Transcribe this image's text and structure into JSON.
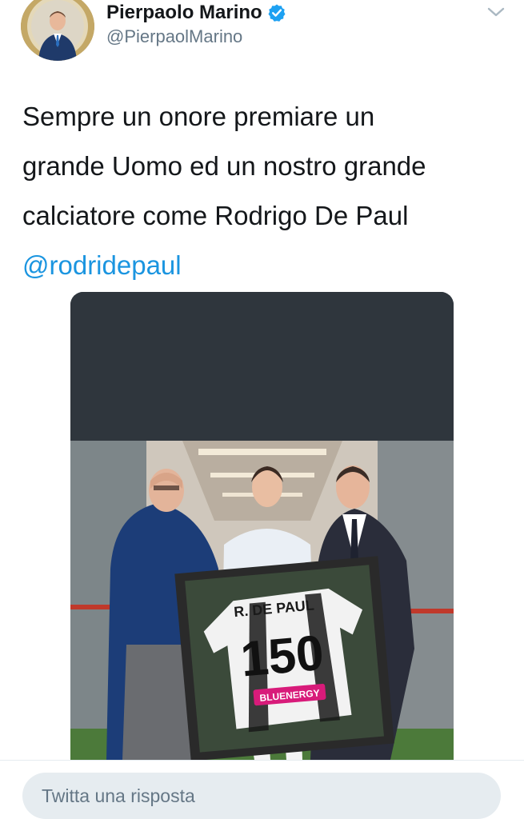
{
  "author": {
    "display_name": "Pierpaolo Marino",
    "handle": "@PierpaolMarino",
    "verified": true
  },
  "tweet": {
    "lines": [
      "Sempre un onore premiare un",
      "grande Uomo ed un nostro grande",
      "calciatore come Rodrigo De Paul"
    ],
    "mention": "@rodridepaul"
  },
  "media": {
    "jersey_name": "R. DE PAUL",
    "jersey_number": "150",
    "sponsor": "BLUENERGY"
  },
  "reply": {
    "placeholder": "Twitta una risposta"
  },
  "colors": {
    "text": "#14171a",
    "secondary": "#657786",
    "link": "#1b95e0",
    "verified_badge": "#1da1f2",
    "reply_bg": "#e6ecf0",
    "media_top": "#2f363d"
  }
}
